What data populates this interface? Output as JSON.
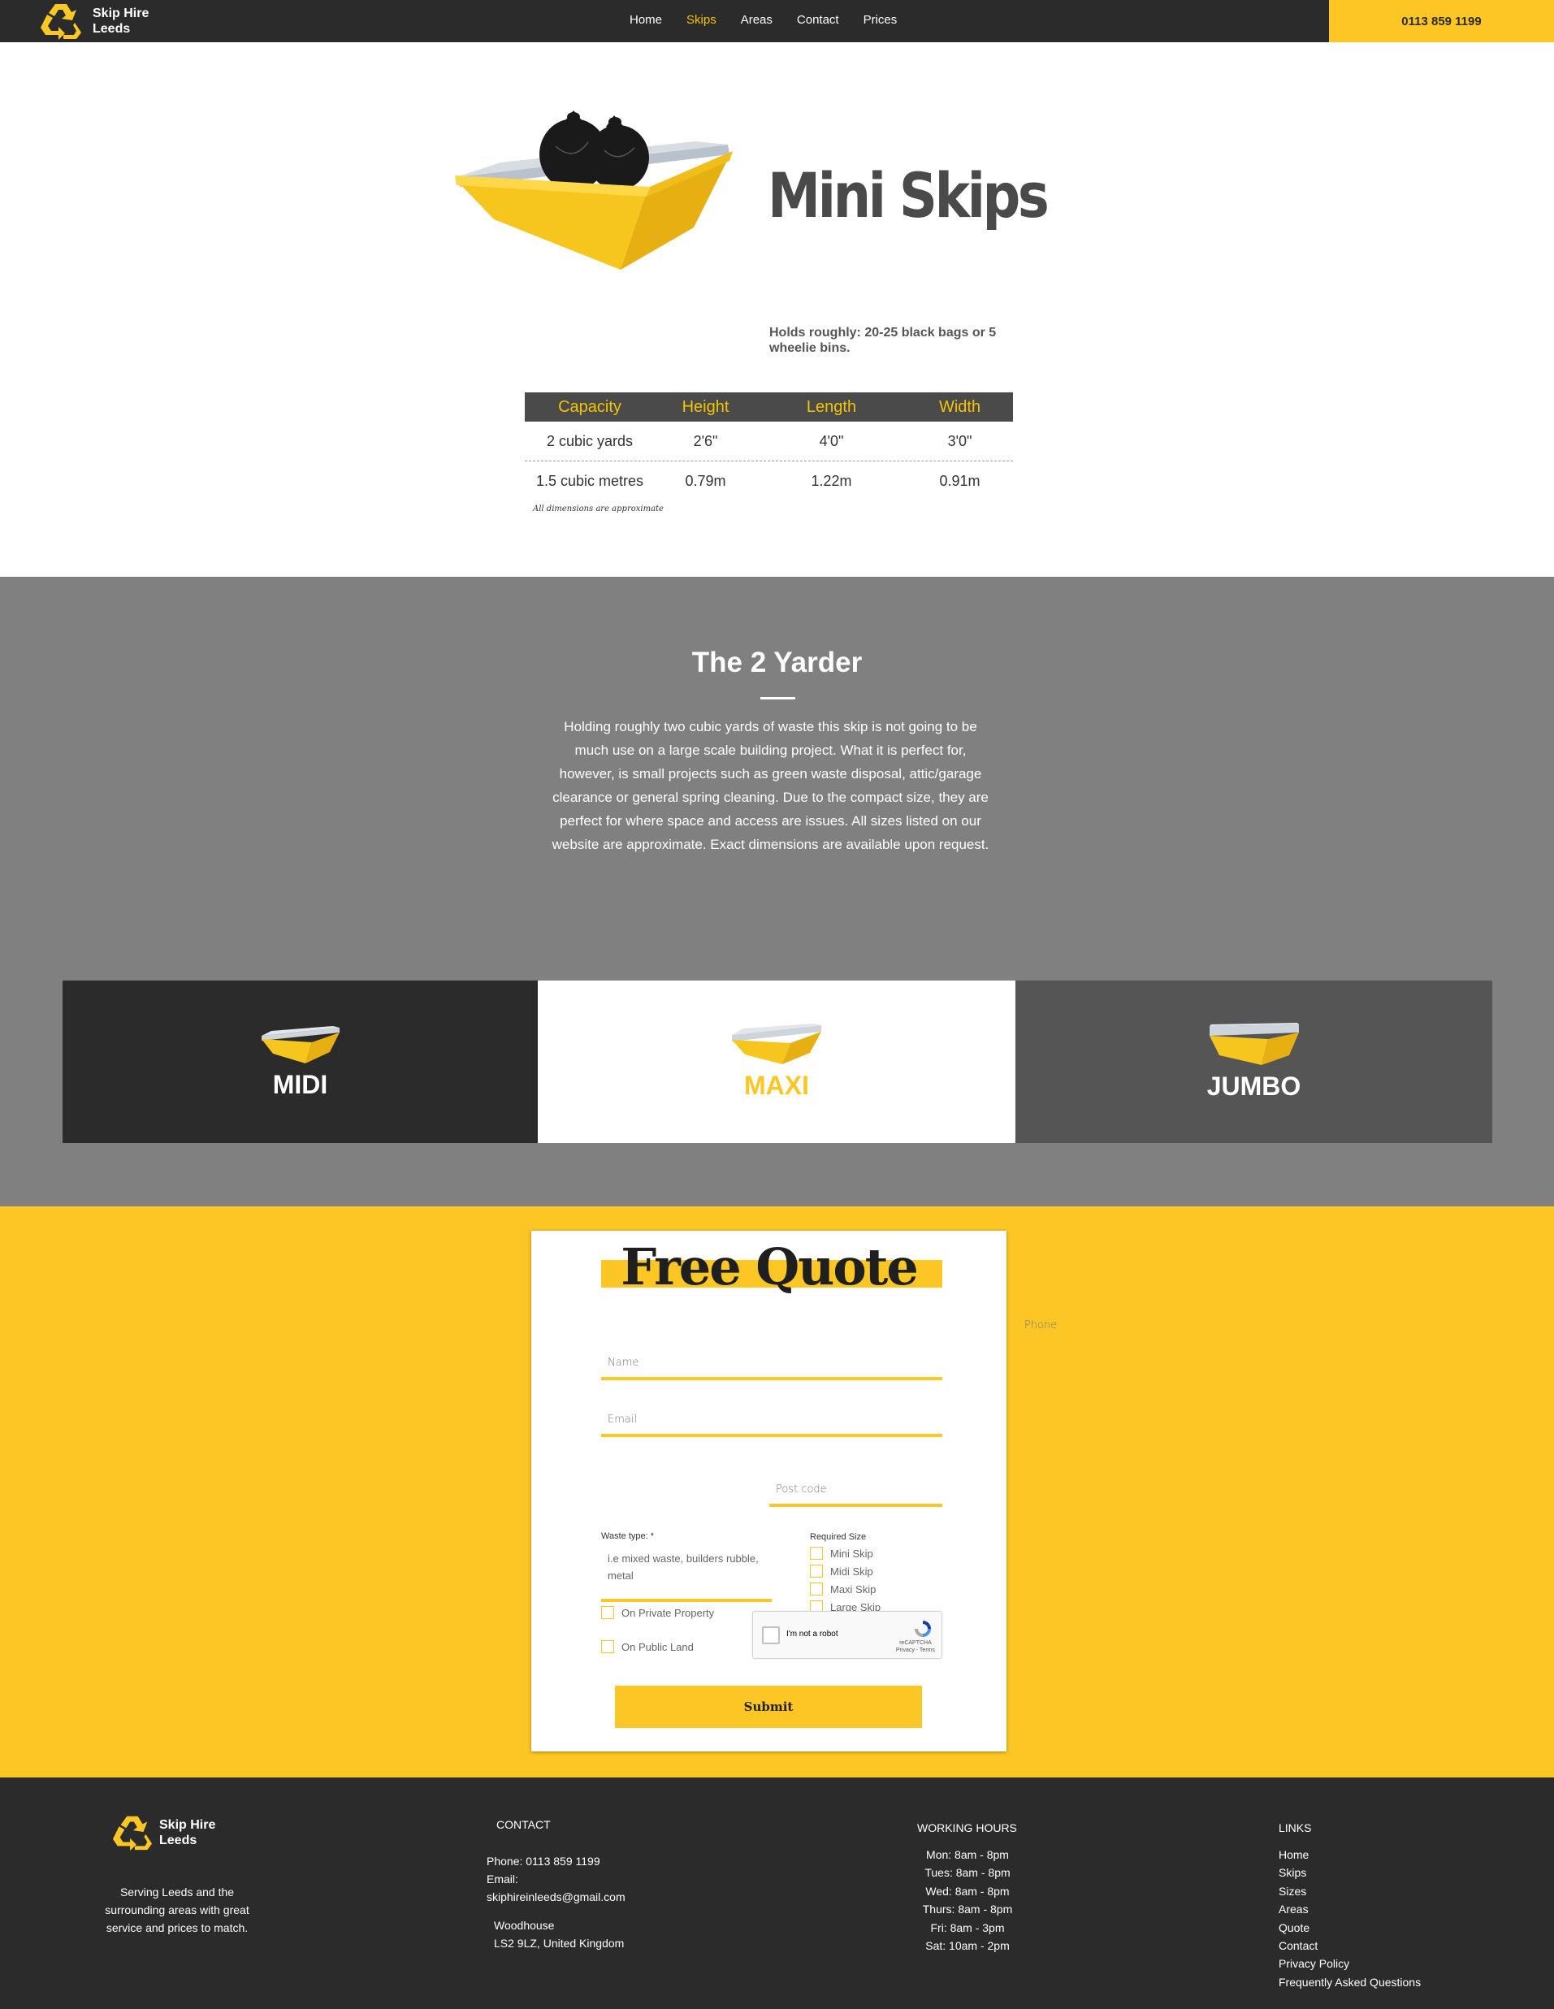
{
  "header": {
    "brand": "Skip Hire Leeds",
    "brand_line1": "Skip Hire",
    "brand_line2": "Leeds",
    "nav": [
      {
        "label": "Home",
        "active": false
      },
      {
        "label": "Skips",
        "active": true
      },
      {
        "label": "Areas",
        "active": false
      },
      {
        "label": "Contact",
        "active": false
      },
      {
        "label": "Prices",
        "active": false
      }
    ],
    "phone": "0113 859 1199"
  },
  "hero": {
    "title": "Mini Skips",
    "holds": "Holds roughly: 20-25 black bags or 5 wheelie bins."
  },
  "spec_table": {
    "headers": [
      "Capacity",
      "Height",
      "Length",
      "Width"
    ],
    "rows": [
      [
        "2 cubic yards",
        "2'6\"",
        "4'0\"",
        "3'0\""
      ],
      [
        "1.5 cubic metres",
        "0.79m",
        "1.22m",
        "0.91m"
      ]
    ],
    "note": "All dimensions are approximate"
  },
  "about": {
    "title": "The 2 Yarder",
    "body": "Holding roughly two cubic yards of waste this skip is not going to be much use on a large scale building project. What it is perfect for, however, is small projects such as green waste disposal, attic/garage clearance or general spring cleaning. Due to the compact size, they are perfect for where space and access are issues. All sizes listed on our website are approximate. Exact dimensions are available upon request."
  },
  "tiles": [
    {
      "label": "MIDI"
    },
    {
      "label": "MAXI"
    },
    {
      "label": "JUMBO"
    }
  ],
  "quote_form": {
    "title": "Free Quote",
    "name_placeholder": "Name",
    "email_placeholder": "Email",
    "phone_placeholder": "Phone",
    "postcode_placeholder": "Post code",
    "waste_label": "Waste type: *",
    "waste_placeholder": "i.e mixed waste, builders rubble, metal",
    "size_label": "Required Size",
    "sizes": [
      "Mini Skip",
      "Midi Skip",
      "Maxi Skip",
      "Large Skip"
    ],
    "land_options": [
      "On Private Property",
      "On Public Land"
    ],
    "recaptcha_text": "I'm not a robot",
    "recaptcha_brand": "reCAPTCHA",
    "recaptcha_links": "Privacy - Terms",
    "submit_label": "Submit"
  },
  "footer": {
    "brand_line1": "Skip Hire",
    "brand_line2": "Leeds",
    "tagline": "Serving Leeds and the surrounding areas with great service and prices to match.",
    "contact_heading": "CONTACT",
    "phone_line": "Phone: 0113 859 1199",
    "email_line": "Email: skiphireinleeds@gmail.com",
    "address_line1": "Woodhouse",
    "address_line2": "LS2 9LZ, United Kingdom",
    "hours_heading": "WORKING HOURS",
    "hours": [
      "Mon: 8am - 8pm",
      "Tues: 8am - 8pm",
      "Wed: 8am - 8pm",
      "Thurs: 8am - 8pm",
      "Fri: 8am - 3pm",
      "Sat: 10am - 2pm"
    ],
    "links_heading": "LINKS",
    "links": [
      "Home",
      "Skips",
      "Sizes",
      "Areas",
      "Quote",
      "Contact",
      "Privacy Policy",
      "Frequently Asked Questions"
    ]
  },
  "colors": {
    "accent_yellow": "#fcc625",
    "dark": "#2b2b2b",
    "grey_section": "#808080",
    "table_head": "#4a4a4a"
  },
  "icons": {
    "logo": "recycle-icon",
    "hero_image": "mini-skip-with-bags-illustration",
    "tile_image": "skip-illustration"
  }
}
